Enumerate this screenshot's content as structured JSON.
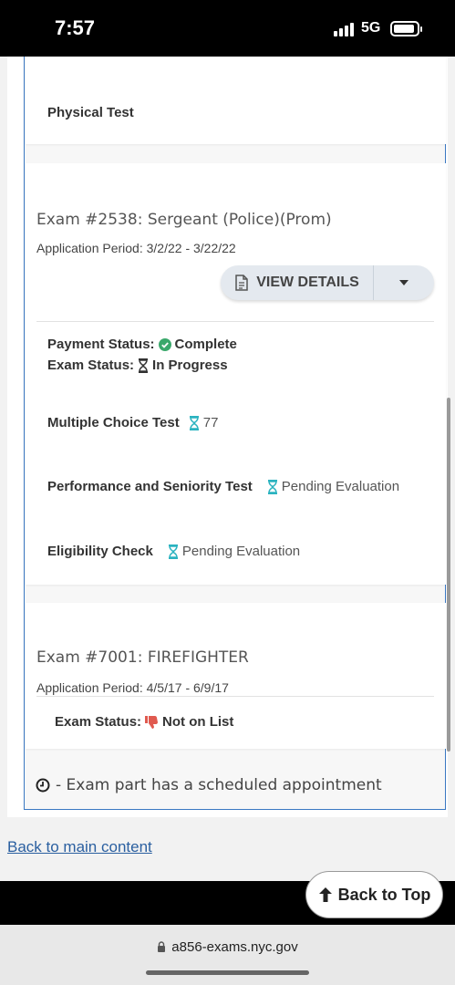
{
  "status_bar": {
    "time": "7:57",
    "network": "5G"
  },
  "prev_card": {
    "physical_test_label": "Physical Test"
  },
  "exam_2538": {
    "title": "Exam #2538: Sergeant (Police)(Prom)",
    "application_period": "Application Period: 3/2/22 - 3/22/22",
    "view_details_label": "VIEW DETAILS",
    "payment_status_label": "Payment Status:",
    "payment_status_value": "Complete",
    "exam_status_label": "Exam Status:",
    "exam_status_value": "In Progress",
    "parts": [
      {
        "label": "Multiple Choice Test",
        "value": "77"
      },
      {
        "label": "Performance and Seniority Test",
        "value": "Pending Evaluation"
      },
      {
        "label": "Eligibility Check",
        "value": "Pending Evaluation"
      }
    ]
  },
  "exam_7001": {
    "title": "Exam #7001: FIREFIGHTER",
    "application_period": "Application Period: 4/5/17 - 6/9/17",
    "exam_status_label": "Exam Status:",
    "exam_status_value": "Not on List"
  },
  "legend_note": "- Exam part has a scheduled appointment",
  "back_to_main": "Back to main content",
  "back_to_top": "Back to Top",
  "url": "a856-exams.nyc.gov",
  "colors": {
    "accent_border": "#3a78c2",
    "complete_green": "#3aa86b",
    "hourglass_teal": "#2bb3c0",
    "thumbs_red": "#e05a4f",
    "link_blue": "#2a5fa0"
  }
}
